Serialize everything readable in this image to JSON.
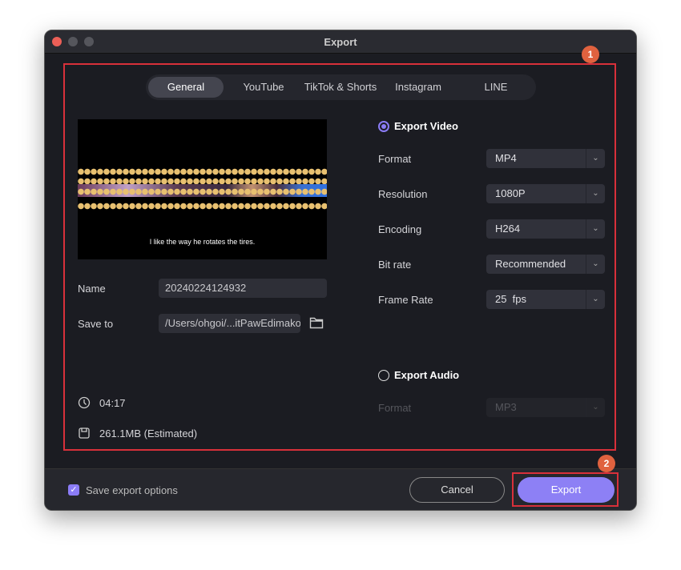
{
  "window": {
    "title": "Export"
  },
  "tabs": [
    {
      "label": "General",
      "active": true
    },
    {
      "label": "YouTube"
    },
    {
      "label": "TikTok & Shorts"
    },
    {
      "label": "Instagram"
    },
    {
      "label": "LINE"
    }
  ],
  "preview": {
    "subtitle": "I like the way he rotates the tires."
  },
  "left": {
    "name_label": "Name",
    "name_value": "20240224124932",
    "save_label": "Save to",
    "save_value": "/Users/ohgoi/...itPawEdimakor",
    "duration": "04:17",
    "size": "261.1MB (Estimated)"
  },
  "video": {
    "label": "Export Video",
    "selected": true,
    "rows": [
      {
        "label": "Format",
        "value": "MP4"
      },
      {
        "label": "Resolution",
        "value": "1080P"
      },
      {
        "label": "Encoding",
        "value": "H264"
      },
      {
        "label": "Bit rate",
        "value": "Recommended"
      },
      {
        "label": "Frame Rate",
        "value": "25  fps"
      }
    ]
  },
  "audio": {
    "label": "Export Audio",
    "selected": false,
    "format_label": "Format",
    "format_value": "MP3"
  },
  "footer": {
    "save_options": "Save export options",
    "save_options_checked": true,
    "cancel": "Cancel",
    "export": "Export"
  },
  "annotations": {
    "badge1": "1",
    "badge2": "2"
  },
  "colors": {
    "accent": "#8b7cf6",
    "annotation": "#d8303a",
    "badge": "#e0623f"
  }
}
